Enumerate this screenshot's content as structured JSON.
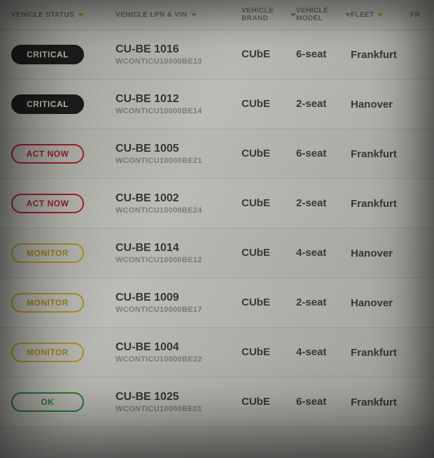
{
  "columns": {
    "status": "VEHICLE STATUS",
    "lpn": "VEHICLE LPN & VIN",
    "brand": "VEHICLE BRAND",
    "model": "VEHICLE MODEL",
    "fleet": "FLEET",
    "extra": "FR"
  },
  "status_labels": {
    "critical": "CRITICAL",
    "actnow": "ACT NOW",
    "monitor": "MONITOR",
    "ok": "OK"
  },
  "rows": [
    {
      "status": "critical",
      "lpn": "CU-BE 1016",
      "vin": "WCONTICU10000BE10",
      "brand": "CUbE",
      "model": "6-seat",
      "fleet": "Frankfurt"
    },
    {
      "status": "critical",
      "lpn": "CU-BE 1012",
      "vin": "WCONTICU10000BE14",
      "brand": "CUbE",
      "model": "2-seat",
      "fleet": "Hanover"
    },
    {
      "status": "actnow",
      "lpn": "CU-BE 1005",
      "vin": "WCONTICU10000BE21",
      "brand": "CUbE",
      "model": "6-seat",
      "fleet": "Frankfurt"
    },
    {
      "status": "actnow",
      "lpn": "CU-BE 1002",
      "vin": "WCONTICU10000BE24",
      "brand": "CUbE",
      "model": "2-seat",
      "fleet": "Frankfurt"
    },
    {
      "status": "monitor",
      "lpn": "CU-BE 1014",
      "vin": "WCONTICU10000BE12",
      "brand": "CUbE",
      "model": "4-seat",
      "fleet": "Hanover"
    },
    {
      "status": "monitor",
      "lpn": "CU-BE 1009",
      "vin": "WCONTICU10000BE17",
      "brand": "CUbE",
      "model": "2-seat",
      "fleet": "Hanover"
    },
    {
      "status": "monitor",
      "lpn": "CU-BE 1004",
      "vin": "WCONTICU10000BE22",
      "brand": "CUbE",
      "model": "4-seat",
      "fleet": "Frankfurt"
    },
    {
      "status": "ok",
      "lpn": "CU-BE 1025",
      "vin": "WCONTICU10000BE01",
      "brand": "CUbE",
      "model": "6-seat",
      "fleet": "Frankfurt"
    }
  ]
}
